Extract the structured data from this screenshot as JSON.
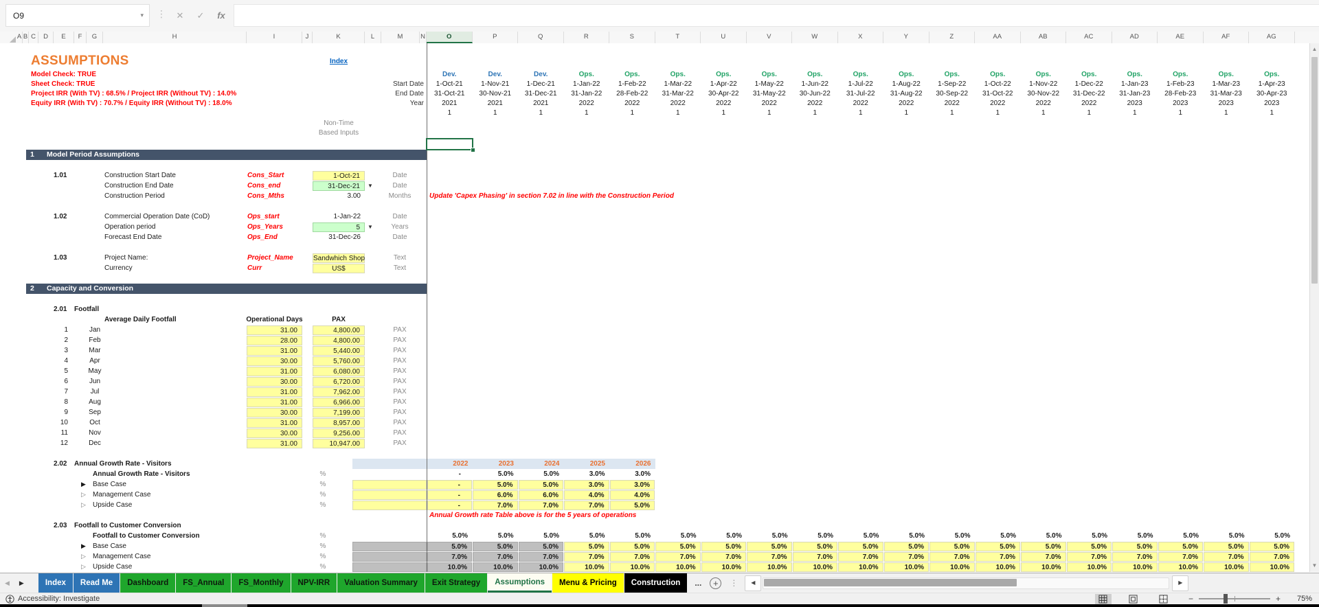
{
  "app": {
    "name_box": "O9",
    "formula": ""
  },
  "column_letters": [
    "A",
    "B",
    "C",
    "D",
    "E",
    "F",
    "G",
    "H",
    "I",
    "J",
    "K",
    "L",
    "M",
    "N",
    "O",
    "P",
    "Q",
    "R",
    "S",
    "T",
    "U",
    "V",
    "W",
    "X",
    "Y",
    "Z",
    "AA",
    "AB",
    "AC",
    "AD",
    "AE",
    "AF",
    "AG"
  ],
  "row_count": 50,
  "sheet": {
    "title": "ASSUMPTIONS",
    "index_link": "Index",
    "check_lines": [
      "Model Check: TRUE",
      "Sheet Check: TRUE",
      "Project IRR  (With TV) : 68.5%  / Project IRR (Without TV) : 14.0%",
      "Equity IRR  (With TV) : 70.7%  / Equity IRR (Without TV) : 18.0%"
    ],
    "non_time_inputs_label": [
      "Non-Time",
      "Based Inputs"
    ],
    "timeline": {
      "row_labels": [
        "Start Date",
        "End Date",
        "Year"
      ],
      "period_number": "1",
      "periods": [
        {
          "phase": "Dev.",
          "start": "1-Oct-21",
          "end": "31-Oct-21",
          "year": "2021"
        },
        {
          "phase": "Dev.",
          "start": "1-Nov-21",
          "end": "30-Nov-21",
          "year": "2021"
        },
        {
          "phase": "Dev.",
          "start": "1-Dec-21",
          "end": "31-Dec-21",
          "year": "2021"
        },
        {
          "phase": "Ops.",
          "start": "1-Jan-22",
          "end": "31-Jan-22",
          "year": "2022"
        },
        {
          "phase": "Ops.",
          "start": "1-Feb-22",
          "end": "28-Feb-22",
          "year": "2022"
        },
        {
          "phase": "Ops.",
          "start": "1-Mar-22",
          "end": "31-Mar-22",
          "year": "2022"
        },
        {
          "phase": "Ops.",
          "start": "1-Apr-22",
          "end": "30-Apr-22",
          "year": "2022"
        },
        {
          "phase": "Ops.",
          "start": "1-May-22",
          "end": "31-May-22",
          "year": "2022"
        },
        {
          "phase": "Ops.",
          "start": "1-Jun-22",
          "end": "30-Jun-22",
          "year": "2022"
        },
        {
          "phase": "Ops.",
          "start": "1-Jul-22",
          "end": "31-Jul-22",
          "year": "2022"
        },
        {
          "phase": "Ops.",
          "start": "1-Aug-22",
          "end": "31-Aug-22",
          "year": "2022"
        },
        {
          "phase": "Ops.",
          "start": "1-Sep-22",
          "end": "30-Sep-22",
          "year": "2022"
        },
        {
          "phase": "Ops.",
          "start": "1-Oct-22",
          "end": "31-Oct-22",
          "year": "2022"
        },
        {
          "phase": "Ops.",
          "start": "1-Nov-22",
          "end": "30-Nov-22",
          "year": "2022"
        },
        {
          "phase": "Ops.",
          "start": "1-Dec-22",
          "end": "31-Dec-22",
          "year": "2022"
        },
        {
          "phase": "Ops.",
          "start": "1-Jan-23",
          "end": "31-Jan-23",
          "year": "2023"
        },
        {
          "phase": "Ops.",
          "start": "1-Feb-23",
          "end": "28-Feb-23",
          "year": "2023"
        },
        {
          "phase": "Ops.",
          "start": "1-Mar-23",
          "end": "31-Mar-23",
          "year": "2023"
        },
        {
          "phase": "Ops.",
          "start": "1-Apr-23",
          "end": "30-Apr-23",
          "year": "2023"
        }
      ]
    },
    "sections": [
      {
        "num": "1",
        "title": "Model Period Assumptions"
      },
      {
        "num": "2",
        "title": "Capacity and Conversion"
      }
    ],
    "model_period": {
      "groups": [
        {
          "id": "1.01",
          "rows": [
            {
              "label": "Construction Start Date",
              "name": "Cons_Start",
              "value": "1-Oct-21",
              "unit": "Date",
              "fill": "yellow",
              "dropdown": false,
              "align": "right"
            },
            {
              "label": "Construction End Date",
              "name": "Cons_end",
              "value": "31-Dec-21",
              "unit": "Date",
              "fill": "green",
              "dropdown": true,
              "align": "right"
            },
            {
              "label": "Construction Period",
              "name": "Cons_Mths",
              "value": "3.00",
              "unit": "Months",
              "fill": "none",
              "dropdown": false,
              "align": "right"
            }
          ]
        },
        {
          "id": "1.02",
          "rows": [
            {
              "label": "Commercial Operation Date (CoD)",
              "name": "Ops_start",
              "value": "1-Jan-22",
              "unit": "Date",
              "fill": "none",
              "dropdown": false,
              "align": "right"
            },
            {
              "label": "Operation period",
              "name": "Ops_Years",
              "value": "5",
              "unit": "Years",
              "fill": "green",
              "dropdown": true,
              "align": "right"
            },
            {
              "label": "Forecast End Date",
              "name": "Ops_End",
              "value": "31-Dec-26",
              "unit": "Date",
              "fill": "none",
              "dropdown": false,
              "align": "right"
            }
          ]
        },
        {
          "id": "1.03",
          "rows": [
            {
              "label": "Project Name:",
              "name": "Project_Name",
              "value": "Sandwhich Shop",
              "unit": "Text",
              "fill": "yellow",
              "dropdown": false,
              "align": "center"
            },
            {
              "label": "Currency",
              "name": "Curr",
              "value": "US$",
              "unit": "Text",
              "fill": "yellow",
              "dropdown": false,
              "align": "center"
            }
          ]
        }
      ],
      "capex_note": "Update 'Capex Phasing' in section 7.02 in line with the Construction Period"
    },
    "footfall": {
      "id": "2.01",
      "title": "Footfall",
      "col_label": "Average Daily Footfall",
      "headers": [
        "Operational Days",
        "PAX"
      ],
      "unit": "PAX",
      "months": [
        {
          "n": "1",
          "name": "Jan",
          "days": "31.00",
          "pax": "4,800.00"
        },
        {
          "n": "2",
          "name": "Feb",
          "days": "28.00",
          "pax": "4,800.00"
        },
        {
          "n": "3",
          "name": "Mar",
          "days": "31.00",
          "pax": "5,440.00"
        },
        {
          "n": "4",
          "name": "Apr",
          "days": "30.00",
          "pax": "5,760.00"
        },
        {
          "n": "5",
          "name": "May",
          "days": "31.00",
          "pax": "6,080.00"
        },
        {
          "n": "6",
          "name": "Jun",
          "days": "30.00",
          "pax": "6,720.00"
        },
        {
          "n": "7",
          "name": "Jul",
          "days": "31.00",
          "pax": "7,962.00"
        },
        {
          "n": "8",
          "name": "Aug",
          "days": "31.00",
          "pax": "6,966.00"
        },
        {
          "n": "9",
          "name": "Sep",
          "days": "30.00",
          "pax": "7,199.00"
        },
        {
          "n": "10",
          "name": "Oct",
          "days": "31.00",
          "pax": "8,957.00"
        },
        {
          "n": "11",
          "name": "Nov",
          "days": "30.00",
          "pax": "9,256.00"
        },
        {
          "n": "12",
          "name": "Dec",
          "days": "31.00",
          "pax": "10,947.00"
        }
      ]
    },
    "growth": {
      "id": "2.02",
      "title": "Annual Growth Rate - Visitors",
      "unit": "%",
      "years": [
        "2022",
        "2023",
        "2024",
        "2025",
        "2026"
      ],
      "rows": [
        {
          "label": "Annual Growth Rate - Visitors",
          "style": "result",
          "arrow": "none",
          "values": [
            "-",
            "5.0%",
            "5.0%",
            "3.0%",
            "3.0%"
          ]
        },
        {
          "label": "Base Case",
          "style": "input",
          "arrow": "filled",
          "values": [
            "-",
            "5.0%",
            "5.0%",
            "3.0%",
            "3.0%"
          ]
        },
        {
          "label": "Management Case",
          "style": "input",
          "arrow": "outline",
          "values": [
            "-",
            "6.0%",
            "6.0%",
            "4.0%",
            "4.0%"
          ]
        },
        {
          "label": "Upside Case",
          "style": "input",
          "arrow": "outline",
          "values": [
            "-",
            "7.0%",
            "7.0%",
            "7.0%",
            "5.0%"
          ]
        }
      ],
      "note": "Annual Growth rate Table above is for the 5 years of operations"
    },
    "conversion": {
      "id": "2.03",
      "title": "Footfall to Customer Conversion",
      "unit": "%",
      "dev_period_columns": 3,
      "rows": [
        {
          "label": "Footfall to Customer Conversion",
          "style": "result",
          "arrow": "none",
          "value": "5.0%"
        },
        {
          "label": "Base Case",
          "style": "input",
          "arrow": "filled",
          "value": "5.0%"
        },
        {
          "label": "Management Case",
          "style": "input",
          "arrow": "outline",
          "value": "7.0%"
        },
        {
          "label": "Upside Case",
          "style": "input",
          "arrow": "outline",
          "value": "10.0%"
        }
      ]
    }
  },
  "tabs": {
    "items": [
      {
        "label": "Index",
        "color": "blue"
      },
      {
        "label": "Read Me",
        "color": "blue"
      },
      {
        "label": "Dashboard",
        "color": "green"
      },
      {
        "label": "FS_Annual",
        "color": "green"
      },
      {
        "label": "FS_Monthly",
        "color": "green"
      },
      {
        "label": "NPV-IRR",
        "color": "green"
      },
      {
        "label": "Valuation Summary",
        "color": "green"
      },
      {
        "label": "Exit Strategy",
        "color": "green"
      },
      {
        "label": "Assumptions",
        "color": "active"
      },
      {
        "label": "Menu & Pricing",
        "color": "yellow"
      },
      {
        "label": "Construction",
        "color": "black"
      }
    ],
    "overflow": "..."
  },
  "status": {
    "left": "Accessibility: Investigate",
    "zoom": "75%"
  },
  "colors": {
    "section_bar": "#44546A",
    "input_yellow": "#FFFF9E",
    "input_green": "#CCFFCC",
    "dev_blue": "#2E75B6",
    "ops_green": "#21A366",
    "accent_orange": "#ED7D31",
    "alert_red": "#FF0000",
    "band_blue": "#DCE6F1",
    "dev_gray": "#BFBFBF",
    "tab_green": "#1FA62C",
    "tab_blue": "#2E74B5",
    "active_green": "#217346",
    "link_blue": "#0563C1"
  }
}
